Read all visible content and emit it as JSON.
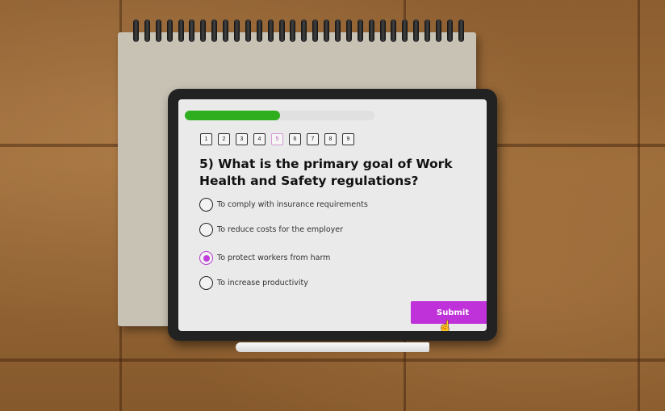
{
  "progress": {
    "fraction": 0.5
  },
  "question_nav": [
    {
      "label": "1",
      "active": false
    },
    {
      "label": "2",
      "active": false
    },
    {
      "label": "3",
      "active": false
    },
    {
      "label": "4",
      "active": false
    },
    {
      "label": "5",
      "active": true
    },
    {
      "label": "6",
      "active": false
    },
    {
      "label": "7",
      "active": false
    },
    {
      "label": "8",
      "active": false
    },
    {
      "label": "9",
      "active": false
    }
  ],
  "question": {
    "text": "5) What is the primary goal of Work Health and Safety regulations?"
  },
  "options": [
    {
      "label": "To comply with insurance requirements",
      "selected": false
    },
    {
      "label": "To reduce costs for the employer",
      "selected": false
    },
    {
      "label": "To protect workers from harm",
      "selected": true
    },
    {
      "label": "To increase productivity",
      "selected": false
    }
  ],
  "submit": {
    "label": "Submit"
  },
  "colors": {
    "progress": "#2fae1f",
    "accent": "#c032d9",
    "active_nav": "#d79ad8"
  },
  "icons": {
    "cursor": "hand-pointer-icon"
  }
}
